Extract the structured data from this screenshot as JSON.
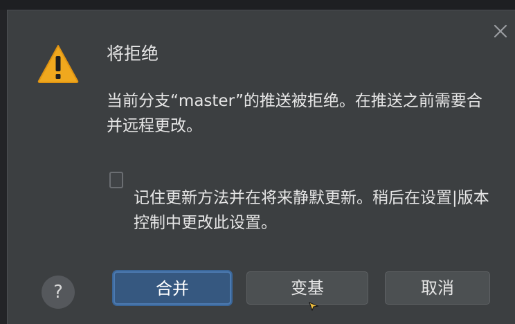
{
  "dialog": {
    "title": "将拒绝",
    "message": "当前分支“master”的推送被拒绝。在推送之前需要合并远程更改。",
    "remember_checked": false,
    "remember_label": "记住更新方法并在将来静默更新。稍后在设置|版本控制中更改此设置。",
    "help_label": "?",
    "buttons": {
      "merge": "合并",
      "rebase": "变基",
      "cancel": "取消"
    },
    "icons": {
      "warning": "warning-icon",
      "close": "close-icon",
      "help": "help-icon"
    },
    "colors": {
      "background": "#3c3f41",
      "warning": "#f0a81e",
      "primary_button": "#365880",
      "text": "#e6e6e6"
    }
  }
}
